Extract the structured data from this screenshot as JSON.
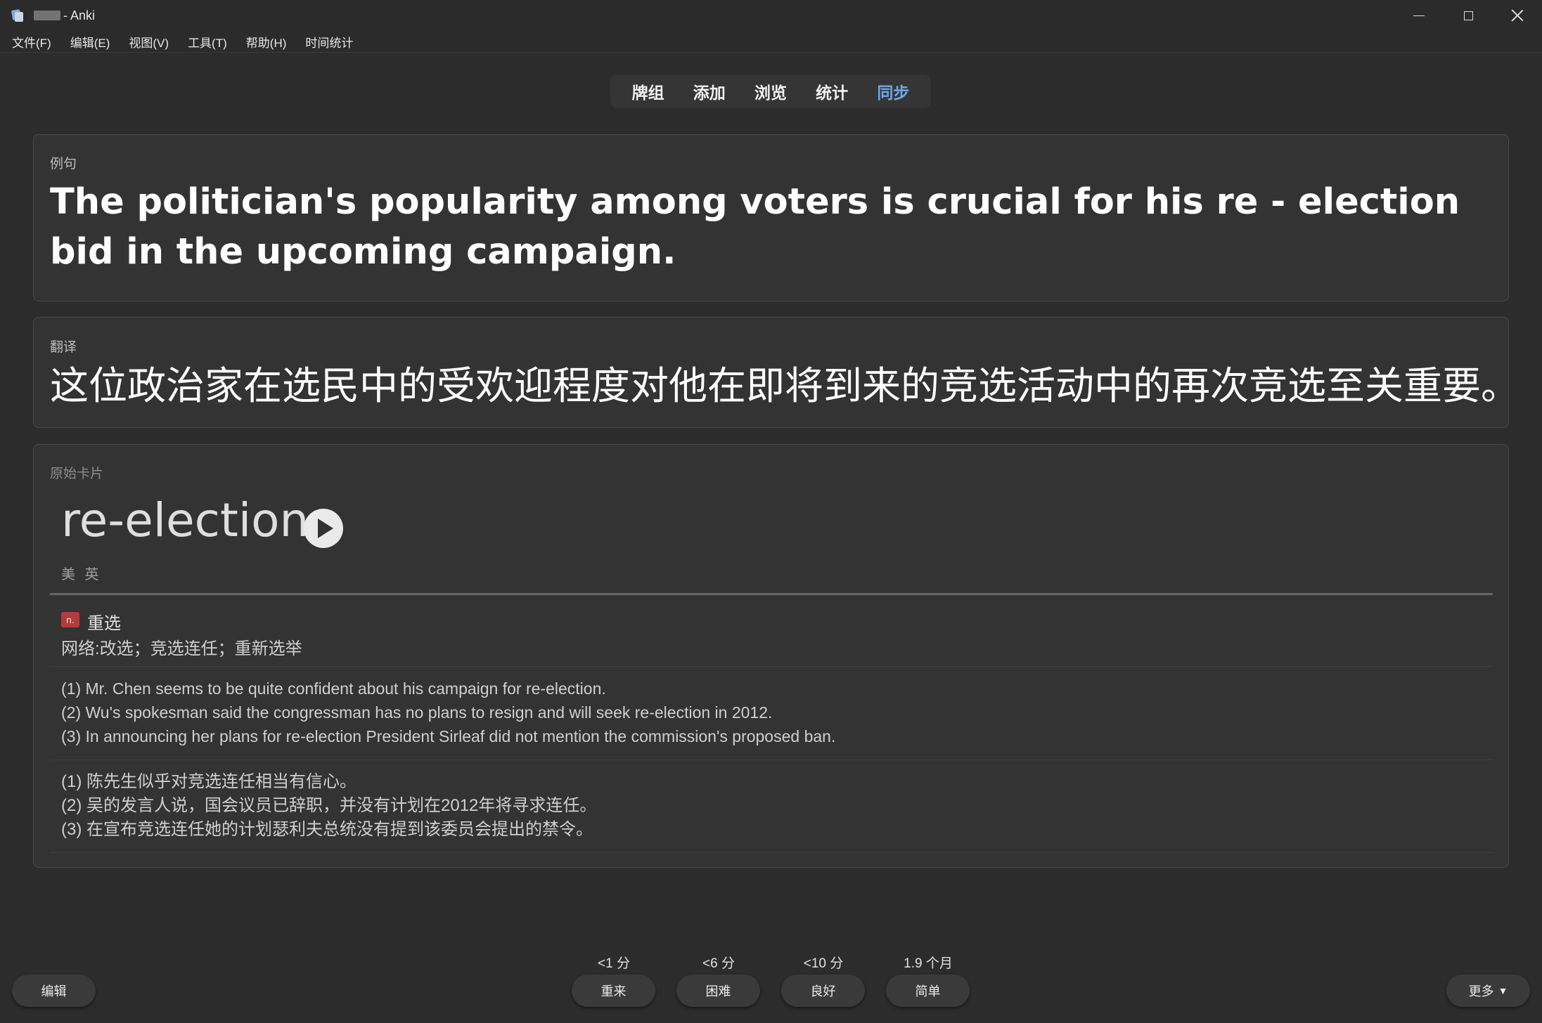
{
  "window": {
    "title": "- Anki",
    "controls": [
      "minimize-icon",
      "maximize-icon",
      "close-icon"
    ]
  },
  "menubar": {
    "items": [
      "文件(F)",
      "编辑(E)",
      "视图(V)",
      "工具(T)",
      "帮助(H)",
      "时间统计"
    ]
  },
  "topnav": {
    "items": [
      "牌组",
      "添加",
      "浏览",
      "统计",
      "同步"
    ],
    "accent_color": "#6ea8e8"
  },
  "card": {
    "sentence_label": "例句",
    "sentence": "The politician's popularity among voters is crucial for his re - election bid in the upcoming campaign.",
    "translation_label": "翻译",
    "translation": "这位政治家在选民中的受欢迎程度对他在即将到来的竞选活动中的再次竞选至关重要。",
    "original_label": "原始卡片",
    "headword": "re-election",
    "phonetic": "美 英",
    "pos": "n.",
    "meaning": "重选",
    "net_meaning": "网络:改选；竞选连任；重新选举",
    "examples_en": [
      "(1) Mr. Chen seems to be quite confident about his campaign for re-election.",
      "(2) Wu's spokesman said the congressman has no plans to resign and will seek re-election in 2012.",
      "(3) In announcing her plans for re-election President Sirleaf did not mention the commission's proposed ban."
    ],
    "examples_zh": [
      "(1) 陈先生似乎对竞选连任相当有信心。",
      "(2) 吴的发言人说，国会议员已辞职，并没有计划在2012年将寻求连任。",
      "(3) 在宣布竞选连任她的计划瑟利夫总统没有提到该委员会提出的禁令。"
    ]
  },
  "bottombar": {
    "edit_label": "编辑",
    "more_label": "更多",
    "answers": [
      {
        "interval": "<1 分",
        "label": "重来"
      },
      {
        "interval": "<6 分",
        "label": "困难"
      },
      {
        "interval": "<10 分",
        "label": "良好"
      },
      {
        "interval": "1.9 个月",
        "label": "简单"
      }
    ]
  }
}
